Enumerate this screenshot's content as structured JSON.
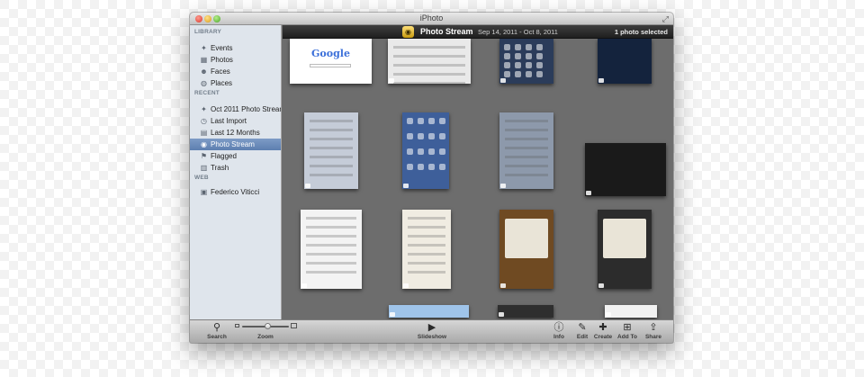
{
  "window": {
    "title": "iPhoto"
  },
  "sidebar": {
    "sections": [
      {
        "heading": "LIBRARY",
        "items": [
          {
            "label": "Events",
            "icon": "events-icon",
            "glyph": "✦"
          },
          {
            "label": "Photos",
            "icon": "photos-icon",
            "glyph": "▦"
          },
          {
            "label": "Faces",
            "icon": "faces-icon",
            "glyph": "☻"
          },
          {
            "label": "Places",
            "icon": "places-icon",
            "glyph": "◍"
          }
        ]
      },
      {
        "heading": "RECENT",
        "items": [
          {
            "label": "Oct 2011 Photo Stream",
            "icon": "event-icon",
            "glyph": "✦"
          },
          {
            "label": "Last Import",
            "icon": "clock-icon",
            "glyph": "◷"
          },
          {
            "label": "Last 12 Months",
            "icon": "calendar-icon",
            "glyph": "▤"
          },
          {
            "label": "Photo Stream",
            "icon": "photo-stream-icon",
            "glyph": "◉",
            "selected": true
          },
          {
            "label": "Flagged",
            "icon": "flag-icon",
            "glyph": "⚑"
          },
          {
            "label": "Trash",
            "icon": "trash-icon",
            "glyph": "▥"
          }
        ]
      },
      {
        "heading": "WEB",
        "items": [
          {
            "label": "Federico Viticci",
            "icon": "web-album-icon",
            "glyph": "▣"
          }
        ]
      }
    ]
  },
  "header": {
    "icon": "photo-stream-icon",
    "glyph": "◉",
    "title": "Photo Stream",
    "dates": "Sep 14, 2011 - Oct 8, 2011",
    "selection": "1 photo selected"
  },
  "thumbnails": [
    {
      "kind": "google",
      "text": "Google",
      "bg": "#ffffff"
    },
    {
      "kind": "settings",
      "bg": "#e9e9e9"
    },
    {
      "kind": "keyboard",
      "bg": "#2b3c5a"
    },
    {
      "kind": "dark-blue",
      "bg": "#14233d"
    },
    {
      "kind": "ios-settings",
      "bg": "#c5ccd8"
    },
    {
      "kind": "homescreen",
      "bg": "#3e5f9a"
    },
    {
      "kind": "ios-alert",
      "bg": "#8d99ab"
    },
    {
      "kind": "black",
      "bg": "#1a1a1a"
    },
    {
      "kind": "document",
      "bg": "#f3f3f3"
    },
    {
      "kind": "list",
      "bg": "#f0ece2"
    },
    {
      "kind": "app-brown",
      "bg": "#6f4a22"
    },
    {
      "kind": "app-dark",
      "bg": "#2c2c2c"
    },
    {
      "kind": "partial-blue",
      "bg": "#9fc4ea"
    },
    {
      "kind": "partial-dark",
      "bg": "#2e2e2e"
    },
    {
      "kind": "partial-light",
      "bg": "#f2f2f2"
    }
  ],
  "toolbar": {
    "left": [
      {
        "label": "Search",
        "icon": "search-icon",
        "glyph": "⚲"
      }
    ],
    "zoom": {
      "label": "Zoom",
      "level": 0.55
    },
    "center": [
      {
        "label": "Slideshow",
        "icon": "play-icon",
        "glyph": "▶"
      }
    ],
    "right": [
      {
        "label": "Info",
        "icon": "info-icon",
        "glyph": "ⓘ"
      },
      {
        "label": "Edit",
        "icon": "pencil-icon",
        "glyph": "✎"
      },
      {
        "label": "Create",
        "icon": "create-icon",
        "glyph": "✚"
      },
      {
        "label": "Add To",
        "icon": "add-to-icon",
        "glyph": "⊞"
      },
      {
        "label": "Share",
        "icon": "share-icon",
        "glyph": "⇪"
      }
    ]
  }
}
